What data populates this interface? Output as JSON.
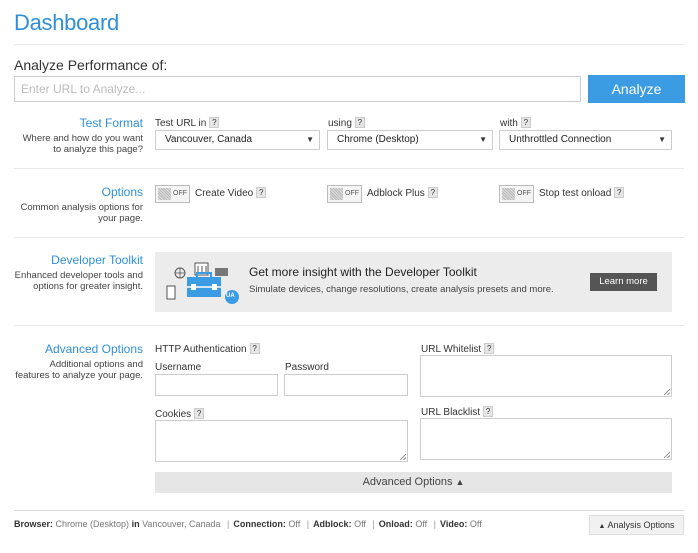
{
  "page": {
    "title": "Dashboard"
  },
  "analyze": {
    "label": "Analyze Performance of:",
    "placeholder": "Enter URL to Analyze...",
    "button": "Analyze"
  },
  "test_format": {
    "title": "Test Format",
    "desc": "Where and how do you want to analyze this page?",
    "location_label": "Test URL in",
    "location_value": "Vancouver, Canada",
    "browser_label": "using",
    "browser_value": "Chrome (Desktop)",
    "connection_label": "with",
    "connection_value": "Unthrottled Connection"
  },
  "options": {
    "title": "Options",
    "desc": "Common analysis options for your page.",
    "toggle_off_text": "OFF",
    "create_video": "Create Video",
    "adblock": "Adblock Plus",
    "stop_onload": "Stop test onload"
  },
  "toolkit": {
    "title": "Developer Toolkit",
    "desc": "Enhanced developer tools and options for greater insight.",
    "heading": "Get more insight with the Developer Toolkit",
    "subtext": "Simulate devices, change resolutions, create analysis presets and more.",
    "learn_more": "Learn more",
    "badge": "UA"
  },
  "advanced": {
    "title": "Advanced Options",
    "desc": "Additional options and features to analyze your page.",
    "http_auth": "HTTP Authentication",
    "username": "Username",
    "password": "Password",
    "cookies": "Cookies",
    "url_whitelist": "URL Whitelist",
    "url_blacklist": "URL Blacklist",
    "toggle_bar": "Advanced Options"
  },
  "help_mark": "?",
  "status_bar": {
    "browser_label": "Browser:",
    "browser_value": "Chrome (Desktop)",
    "in_word": "in",
    "location_value": "Vancouver, Canada",
    "connection_label": "Connection:",
    "connection_value": "Off",
    "adblock_label": "Adblock:",
    "adblock_value": "Off",
    "onload_label": "Onload:",
    "onload_value": "Off",
    "video_label": "Video:",
    "video_value": "Off",
    "separator": "|",
    "analysis_options": "Analysis Options"
  },
  "colors": {
    "accent": "#2f8fd8",
    "button": "#3b9be3"
  }
}
